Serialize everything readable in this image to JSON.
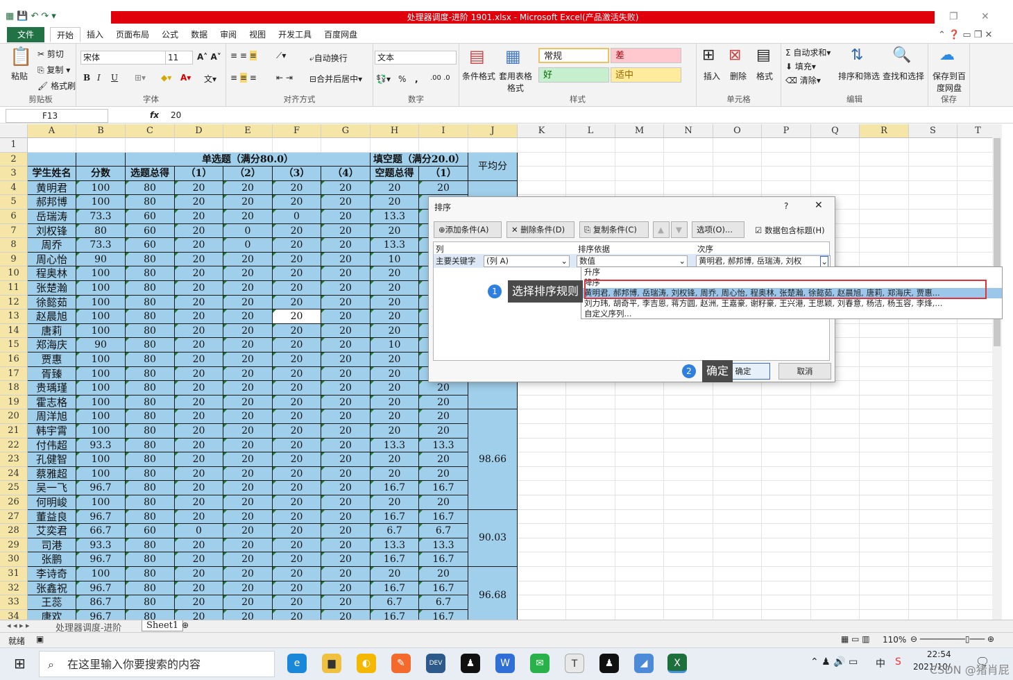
{
  "window": {
    "title": "处理器调度-进阶 1901.xlsx - Microsoft Excel(产品激活失败)"
  },
  "ribbon_tabs": [
    "文件",
    "开始",
    "插入",
    "页面布局",
    "公式",
    "数据",
    "审阅",
    "视图",
    "开发工具",
    "百度网盘"
  ],
  "ribbon": {
    "clipboard": {
      "paste": "粘贴",
      "cut": "剪切",
      "copy": "复制",
      "painter": "格式刷",
      "label": "剪贴板"
    },
    "font": {
      "name": "宋体",
      "size": "11",
      "bold": "B",
      "italic": "I",
      "underline": "U",
      "label": "字体"
    },
    "align": {
      "wrap": "自动换行",
      "merge": "合并后居中",
      "label": "对齐方式"
    },
    "number": {
      "format": "文本",
      "percent": "%",
      "comma": ",",
      "label": "数字"
    },
    "styles": {
      "cond": "条件格式",
      "table": "套用表格格式",
      "normal": "常规",
      "bad": "差",
      "good": "好",
      "neutral": "适中",
      "label": "样式"
    },
    "cells": {
      "insert": "插入",
      "delete": "删除",
      "format": "格式",
      "label": "单元格"
    },
    "editing": {
      "autosum": "自动求和",
      "fill": "填充",
      "clear": "清除",
      "sort": "排序和筛选",
      "find": "查找和选择",
      "label": "编辑"
    },
    "save": {
      "baidu": "保存到百度网盘",
      "label": "保存"
    }
  },
  "formula_bar": {
    "name_box": "F13",
    "fx": "fx",
    "value": "20"
  },
  "columns": [
    "A",
    "B",
    "C",
    "D",
    "E",
    "F",
    "G",
    "H",
    "I",
    "J",
    "K",
    "L",
    "M",
    "N",
    "O",
    "P",
    "Q",
    "R",
    "S",
    "T"
  ],
  "rows": [
    "1",
    "2",
    "3",
    "4",
    "5",
    "6",
    "7",
    "8",
    "9",
    "10",
    "11",
    "12",
    "13",
    "14",
    "15",
    "16",
    "17",
    "18",
    "19",
    "20",
    "21",
    "22",
    "23",
    "24",
    "25",
    "26",
    "27",
    "28",
    "29",
    "30",
    "31",
    "32",
    "33",
    "34"
  ],
  "table": {
    "group_headers": {
      "single": "单选题（满分80.0）",
      "fill": "填空题（满分20.0）",
      "avg": "平均分"
    },
    "headers": [
      "学生姓名",
      "分数",
      "选题总得",
      "（1）",
      "（2）",
      "（3）",
      "（4）",
      "空题总得",
      "（1）"
    ],
    "data": [
      [
        "黄明君",
        "100",
        "80",
        "20",
        "20",
        "20",
        "20",
        "20",
        "20"
      ],
      [
        "郝邦博",
        "100",
        "80",
        "20",
        "20",
        "20",
        "20",
        "20",
        ""
      ],
      [
        "岳瑞涛",
        "73.3",
        "60",
        "20",
        "20",
        "0",
        "20",
        "13.3",
        ""
      ],
      [
        "刘权锋",
        "80",
        "60",
        "20",
        "0",
        "20",
        "20",
        "20",
        ""
      ],
      [
        "周乔",
        "73.3",
        "60",
        "20",
        "0",
        "20",
        "20",
        "13.3",
        ""
      ],
      [
        "周心怡",
        "90",
        "80",
        "20",
        "20",
        "20",
        "20",
        "10",
        ""
      ],
      [
        "程奥林",
        "100",
        "80",
        "20",
        "20",
        "20",
        "20",
        "20",
        ""
      ],
      [
        "张楚瀚",
        "100",
        "80",
        "20",
        "20",
        "20",
        "20",
        "20",
        ""
      ],
      [
        "徐懿茹",
        "100",
        "80",
        "20",
        "20",
        "20",
        "20",
        "20",
        ""
      ],
      [
        "赵晨旭",
        "100",
        "80",
        "20",
        "20",
        "20",
        "20",
        "20",
        ""
      ],
      [
        "唐莉",
        "100",
        "80",
        "20",
        "20",
        "20",
        "20",
        "20",
        ""
      ],
      [
        "郑海庆",
        "90",
        "80",
        "20",
        "20",
        "20",
        "20",
        "10",
        ""
      ],
      [
        "贾惠",
        "100",
        "80",
        "20",
        "20",
        "20",
        "20",
        "20",
        ""
      ],
      [
        "胥臻",
        "100",
        "80",
        "20",
        "20",
        "20",
        "20",
        "20",
        ""
      ],
      [
        "贵瑀瑾",
        "100",
        "80",
        "20",
        "20",
        "20",
        "20",
        "20",
        "20"
      ],
      [
        "霍志格",
        "100",
        "80",
        "20",
        "20",
        "20",
        "20",
        "20",
        "20"
      ],
      [
        "周洋旭",
        "100",
        "80",
        "20",
        "20",
        "20",
        "20",
        "20",
        "20"
      ],
      [
        "韩宇霄",
        "100",
        "80",
        "20",
        "20",
        "20",
        "20",
        "20",
        "20"
      ],
      [
        "付伟超",
        "93.3",
        "80",
        "20",
        "20",
        "20",
        "20",
        "13.3",
        "13.3"
      ],
      [
        "孔健智",
        "100",
        "80",
        "20",
        "20",
        "20",
        "20",
        "20",
        "20"
      ],
      [
        "蔡雅超",
        "100",
        "80",
        "20",
        "20",
        "20",
        "20",
        "20",
        "20"
      ],
      [
        "吴一飞",
        "96.7",
        "80",
        "20",
        "20",
        "20",
        "20",
        "16.7",
        "16.7"
      ],
      [
        "何明峻",
        "100",
        "80",
        "20",
        "20",
        "20",
        "20",
        "20",
        "20"
      ],
      [
        "董益良",
        "96.7",
        "80",
        "20",
        "20",
        "20",
        "20",
        "16.7",
        "16.7"
      ],
      [
        "艾奕君",
        "66.7",
        "60",
        "0",
        "20",
        "20",
        "20",
        "6.7",
        "6.7"
      ],
      [
        "司港",
        "93.3",
        "80",
        "20",
        "20",
        "20",
        "20",
        "13.3",
        "13.3"
      ],
      [
        "张鹏",
        "96.7",
        "80",
        "20",
        "20",
        "20",
        "20",
        "16.7",
        "16.7"
      ],
      [
        "李诗奇",
        "100",
        "80",
        "20",
        "20",
        "20",
        "20",
        "20",
        "20"
      ],
      [
        "张鑫祝",
        "96.7",
        "80",
        "20",
        "20",
        "20",
        "20",
        "16.7",
        "16.7"
      ],
      [
        "王蕊",
        "86.7",
        "80",
        "20",
        "20",
        "20",
        "20",
        "6.7",
        "6.7"
      ],
      [
        "唐欢",
        "96.7",
        "80",
        "20",
        "20",
        "20",
        "20",
        "16.7",
        "16.7"
      ]
    ],
    "averages": [
      "98.66",
      "90.03",
      "96.68"
    ]
  },
  "sort_dialog": {
    "title": "排序",
    "help": "?",
    "close": "✕",
    "add": "添加条件(A)",
    "delete": "删除条件(D)",
    "copy": "复制条件(C)",
    "options": "选项(O)...",
    "has_header": "数据包含标题(H)",
    "col_header": "列",
    "basis_header": "排序依据",
    "order_header": "次序",
    "primary_key": "主要关键字",
    "key_value": "(列 A)",
    "basis_value": "数值",
    "order_value": "黄明君, 郝邦博, 岳瑞涛, 刘权",
    "ok": "确定",
    "cancel": "取消"
  },
  "order_dropdown": [
    "升序",
    "降序",
    "黄明君, 郝邦博, 岳瑞涛, 刘权锋, 周乔, 周心怡, 程奥林, 张楚瀚, 徐懿茹, 赵晨旭, 唐莉, 郑海庆, 贾惠...",
    "刘力玮, 胡奇平, 李吉恩, 蒋方圆, 赵洲, 王嘉豪, 谢籽豪, 王兴港, 王思颖, 刘春意, 杨洁, 杨玉容, 李烽,...",
    "自定义序列..."
  ],
  "callouts": {
    "step1_num": "1",
    "step1": "选择排序规则",
    "step2_num": "2",
    "step2": "确定"
  },
  "sheets": {
    "tab1": "处理器调度-进阶",
    "tab2": "Sheet1"
  },
  "status": {
    "ready": "就绪",
    "zoom": "110%"
  },
  "taskbar": {
    "search": "在这里输入你要搜索的内容",
    "ime": "中",
    "time": "22:54",
    "date": "2021/10/",
    "watermark": "CSDN @猪肖屁"
  }
}
